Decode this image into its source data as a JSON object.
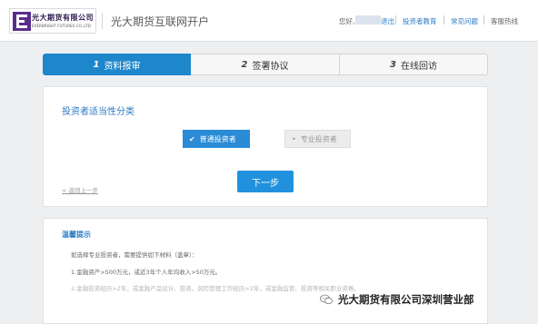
{
  "header": {
    "logo_cn": "光大期货有限公司",
    "logo_en": "EVERBRIGHT FUTURES CO.,LTD",
    "site_title": "光大期货互联网开户",
    "greeting": "您好,",
    "logout_label": "退出",
    "links": [
      "投资者教育",
      "常见问题"
    ],
    "hotline": "客服热线"
  },
  "steps": [
    {
      "num": "1",
      "label": "资料报审",
      "active": true
    },
    {
      "num": "2",
      "label": "签署协议",
      "active": false
    },
    {
      "num": "3",
      "label": "在线回访",
      "active": false
    }
  ],
  "main": {
    "section_title": "投资者适当性分类",
    "investor_types": [
      {
        "label": "普通投资者",
        "selected": true
      },
      {
        "label": "专业投资者",
        "selected": false
      }
    ],
    "back_label": "< 返回上一步",
    "next_label": "下一步"
  },
  "tips": {
    "title": "温馨提示",
    "lines": [
      "如选择专业投资者，需要提供如下材料（盖章）：",
      "1.金融资产>500万元，或近3年个人年均收入>50万元。",
      "2.金融投资经历>2年，或金融产品设计、投资，风险管理工作经历>2年，或金融监管、投资等相关职业资格。"
    ]
  },
  "watermark": "光大期货有限公司深圳营业部",
  "colors": {
    "accent": "#1e87cc",
    "link": "#2a7ac4",
    "background": "#eeeff1"
  }
}
